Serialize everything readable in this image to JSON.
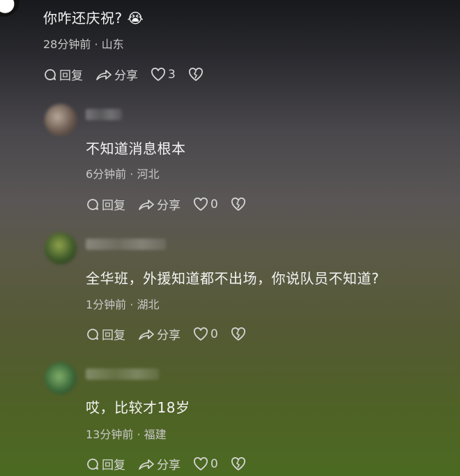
{
  "comments": [
    {
      "text": "你咋还庆祝? 😭",
      "time": "28分钟前",
      "location": "山东",
      "reply_label": "回复",
      "share_label": "分享",
      "likes": "3"
    },
    {
      "text": "不知道消息根本",
      "time": "6分钟前",
      "location": "河北",
      "reply_label": "回复",
      "share_label": "分享",
      "likes": "0"
    },
    {
      "text": "全华班，外援知道都不出场，你说队员不知道?",
      "time": "1分钟前",
      "location": "湖北",
      "reply_label": "回复",
      "share_label": "分享",
      "likes": "0"
    },
    {
      "text": "哎，比较才18岁",
      "time": "13分钟前",
      "location": "福建",
      "reply_label": "回复",
      "share_label": "分享",
      "likes": "0"
    }
  ],
  "separator": "·",
  "icons": {
    "reply": "comment-bubble-icon",
    "share": "share-arrow-icon",
    "like": "heart-icon",
    "dislike": "broken-heart-icon"
  }
}
